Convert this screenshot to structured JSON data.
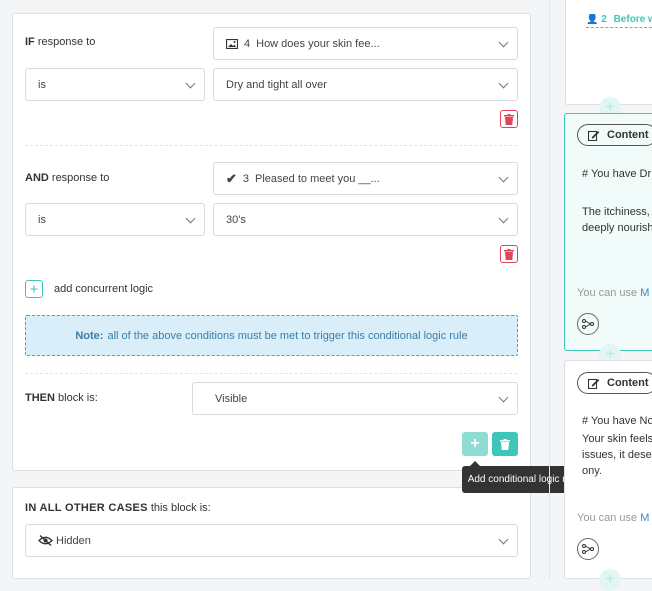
{
  "colors": {
    "teal": "#3ec7b8",
    "teal_light": "#8fdcd3",
    "danger": "#e0455a",
    "note_bg": "#daeefa",
    "note_text": "#3b7ea8"
  },
  "rule1": {
    "if_bold": "IF",
    "if_rest": "response to",
    "question_num": "4",
    "question_text": "How does your skin fee...",
    "question_icon": "image-icon",
    "operator": "is",
    "value": "Dry and tight all over"
  },
  "rule2": {
    "and_bold": "AND",
    "and_rest": "response to",
    "question_num": "3",
    "question_text": "Pleased to meet you __...",
    "question_icon": "checkmark-icon",
    "operator": "is",
    "value": "30's"
  },
  "add_concurrent_logic": "add concurrent logic",
  "note": {
    "bold": "Note:",
    "text": "all of the above conditions must be met to trigger this conditional logic rule"
  },
  "then": {
    "bold": "THEN",
    "rest": "block is:",
    "value": "Visible"
  },
  "tooltip": "Add conditional logic rule (OR)",
  "other_cases": {
    "bold": "IN ALL OTHER CASES",
    "rest": "this block is:",
    "value": "Hidden",
    "icon": "eye-slash-icon"
  },
  "right": {
    "top_link_num": "2",
    "top_link_text": "Before w",
    "block1": {
      "pill": "Content",
      "line1": "# You have Dr",
      "line2": "The itchiness,",
      "line3": "deeply nourish",
      "footer_prefix": "You can use",
      "footer_link": "M"
    },
    "block2": {
      "pill": "Content",
      "line1": "# You have No",
      "line2": "Your skin feels",
      "line3": "issues, it dese",
      "line4": "ony.",
      "footer_prefix": "You can use",
      "footer_link": "M"
    }
  }
}
